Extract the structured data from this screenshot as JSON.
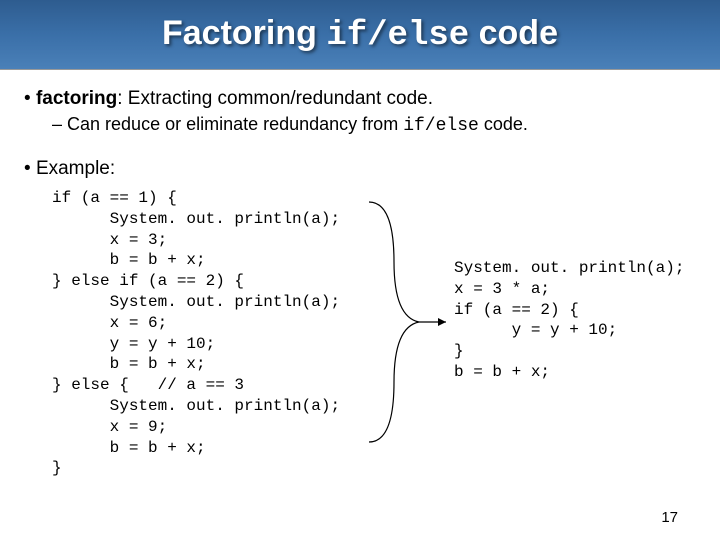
{
  "title": {
    "pre": "Factoring ",
    "mono": "if/else",
    "post": " code"
  },
  "bullet1": {
    "term": "factoring",
    "rest": ": Extracting common/redundant code."
  },
  "subbullet1": {
    "pre": "Can reduce or eliminate redundancy from ",
    "mono": "if/else",
    "post": " code."
  },
  "example_label": "Example:",
  "code_left": "if (a == 1) {\n      System. out. println(a);\n      x = 3;\n      b = b + x;\n} else if (a == 2) {\n      System. out. println(a);\n      x = 6;\n      y = y + 10;\n      b = b + x;\n} else {   // a == 3\n      System. out. println(a);\n      x = 9;\n      b = b + x;\n}",
  "code_right": "System. out. println(a);\nx = 3 * a;\nif (a == 2) {\n      y = y + 10;\n}\nb = b + x;",
  "slide_number": "17"
}
